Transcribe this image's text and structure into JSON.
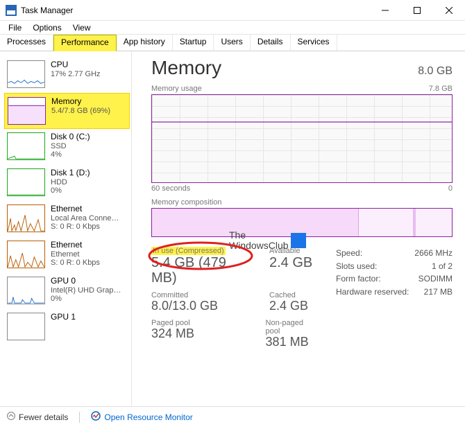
{
  "window": {
    "title": "Task Manager"
  },
  "menus": [
    "File",
    "Options",
    "View"
  ],
  "tabs": [
    "Processes",
    "Performance",
    "App history",
    "Startup",
    "Users",
    "Details",
    "Services"
  ],
  "active_tab": "Performance",
  "sidebar": [
    {
      "name": "CPU",
      "sub1": "17%  2.77 GHz",
      "sub2": "",
      "color": "#1f6fd0"
    },
    {
      "name": "Memory",
      "sub1": "5.4/7.8 GB (69%)",
      "sub2": "",
      "color": "#8b1ea0",
      "selected": true
    },
    {
      "name": "Disk 0 (C:)",
      "sub1": "SSD",
      "sub2": "4%",
      "color": "#1aa51a"
    },
    {
      "name": "Disk 1 (D:)",
      "sub1": "HDD",
      "sub2": "0%",
      "color": "#1aa51a"
    },
    {
      "name": "Ethernet",
      "sub1": "Local Area Conne…",
      "sub2": "S: 0  R: 0 Kbps",
      "color": "#b85c00"
    },
    {
      "name": "Ethernet",
      "sub1": "Ethernet",
      "sub2": "S: 0  R: 0 Kbps",
      "color": "#b85c00"
    },
    {
      "name": "GPU 0",
      "sub1": "Intel(R) UHD Grap…",
      "sub2": "0%",
      "color": "#1f6fd0"
    },
    {
      "name": "GPU 1",
      "sub1": "",
      "sub2": "",
      "color": "#1f6fd0"
    }
  ],
  "panel": {
    "title": "Memory",
    "total": "8.0 GB",
    "usage_label": "Memory usage",
    "usage_max": "7.8 GB",
    "x_left": "60 seconds",
    "x_right": "0",
    "composition_label": "Memory composition",
    "stats": {
      "in_use_label": "In use (Compressed)",
      "in_use_value": "5.4 GB (479 MB)",
      "available_label": "Available",
      "available_value": "2.4 GB",
      "committed_label": "Committed",
      "committed_value": "8.0/13.0 GB",
      "cached_label": "Cached",
      "cached_value": "2.4 GB",
      "paged_label": "Paged pool",
      "paged_value": "324 MB",
      "nonpaged_label": "Non-paged pool",
      "nonpaged_value": "381 MB"
    },
    "right": {
      "speed_label": "Speed:",
      "speed_value": "2666 MHz",
      "slots_label": "Slots used:",
      "slots_value": "1 of 2",
      "form_label": "Form factor:",
      "form_value": "SODIMM",
      "reserved_label": "Hardware reserved:",
      "reserved_value": "217 MB"
    }
  },
  "watermark": {
    "line1": "The",
    "line2": "WindowsClub"
  },
  "bottom": {
    "fewer": "Fewer details",
    "link": "Open Resource Monitor"
  }
}
